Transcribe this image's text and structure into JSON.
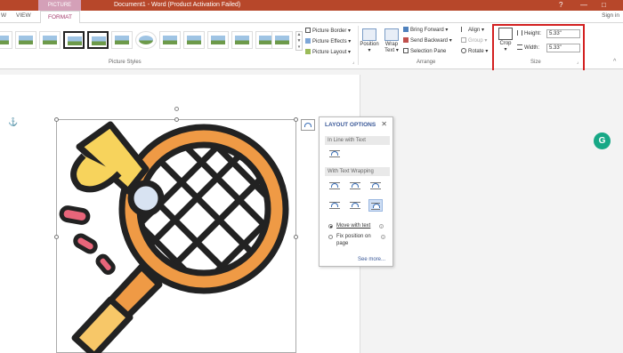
{
  "titlebar": {
    "context_tab": "PICTURE TOOLS",
    "title": "Document1 - Word (Product Activation Failed)",
    "help": "?",
    "minimize": "—",
    "restore": "□"
  },
  "tabs": {
    "view": "VIEW",
    "partial": "W",
    "format": "FORMAT",
    "signin": "Sign in"
  },
  "ribbon": {
    "picture_styles_label": "Picture Styles",
    "arrange_label": "Arrange",
    "size_label": "Size",
    "picture_border": "Picture Border",
    "picture_effects": "Picture Effects",
    "picture_layout": "Picture Layout",
    "position": "Position",
    "wrap_text_1": "Wrap",
    "wrap_text_2": "Text",
    "bring_forward": "Bring Forward",
    "send_backward": "Send Backward",
    "selection_pane": "Selection Pane",
    "align": "Align",
    "group": "Group",
    "rotate": "Rotate",
    "crop": "Crop",
    "height_label": "Height:",
    "height_value": "5.33\"",
    "width_label": "Width:",
    "width_value": "5.33\""
  },
  "layout_options": {
    "title": "LAYOUT OPTIONS",
    "close": "✕",
    "inline_section": "In Line with Text",
    "wrapping_section": "With Text Wrapping",
    "move_with_text": "Move with text",
    "fix_position_1": "Fix position on",
    "fix_position_2": "page",
    "see_more": "See more..."
  },
  "grammarly": "G",
  "colors": {
    "titlebar": "#b7472a",
    "accent": "#a33b6c",
    "highlight": "#d32020"
  }
}
